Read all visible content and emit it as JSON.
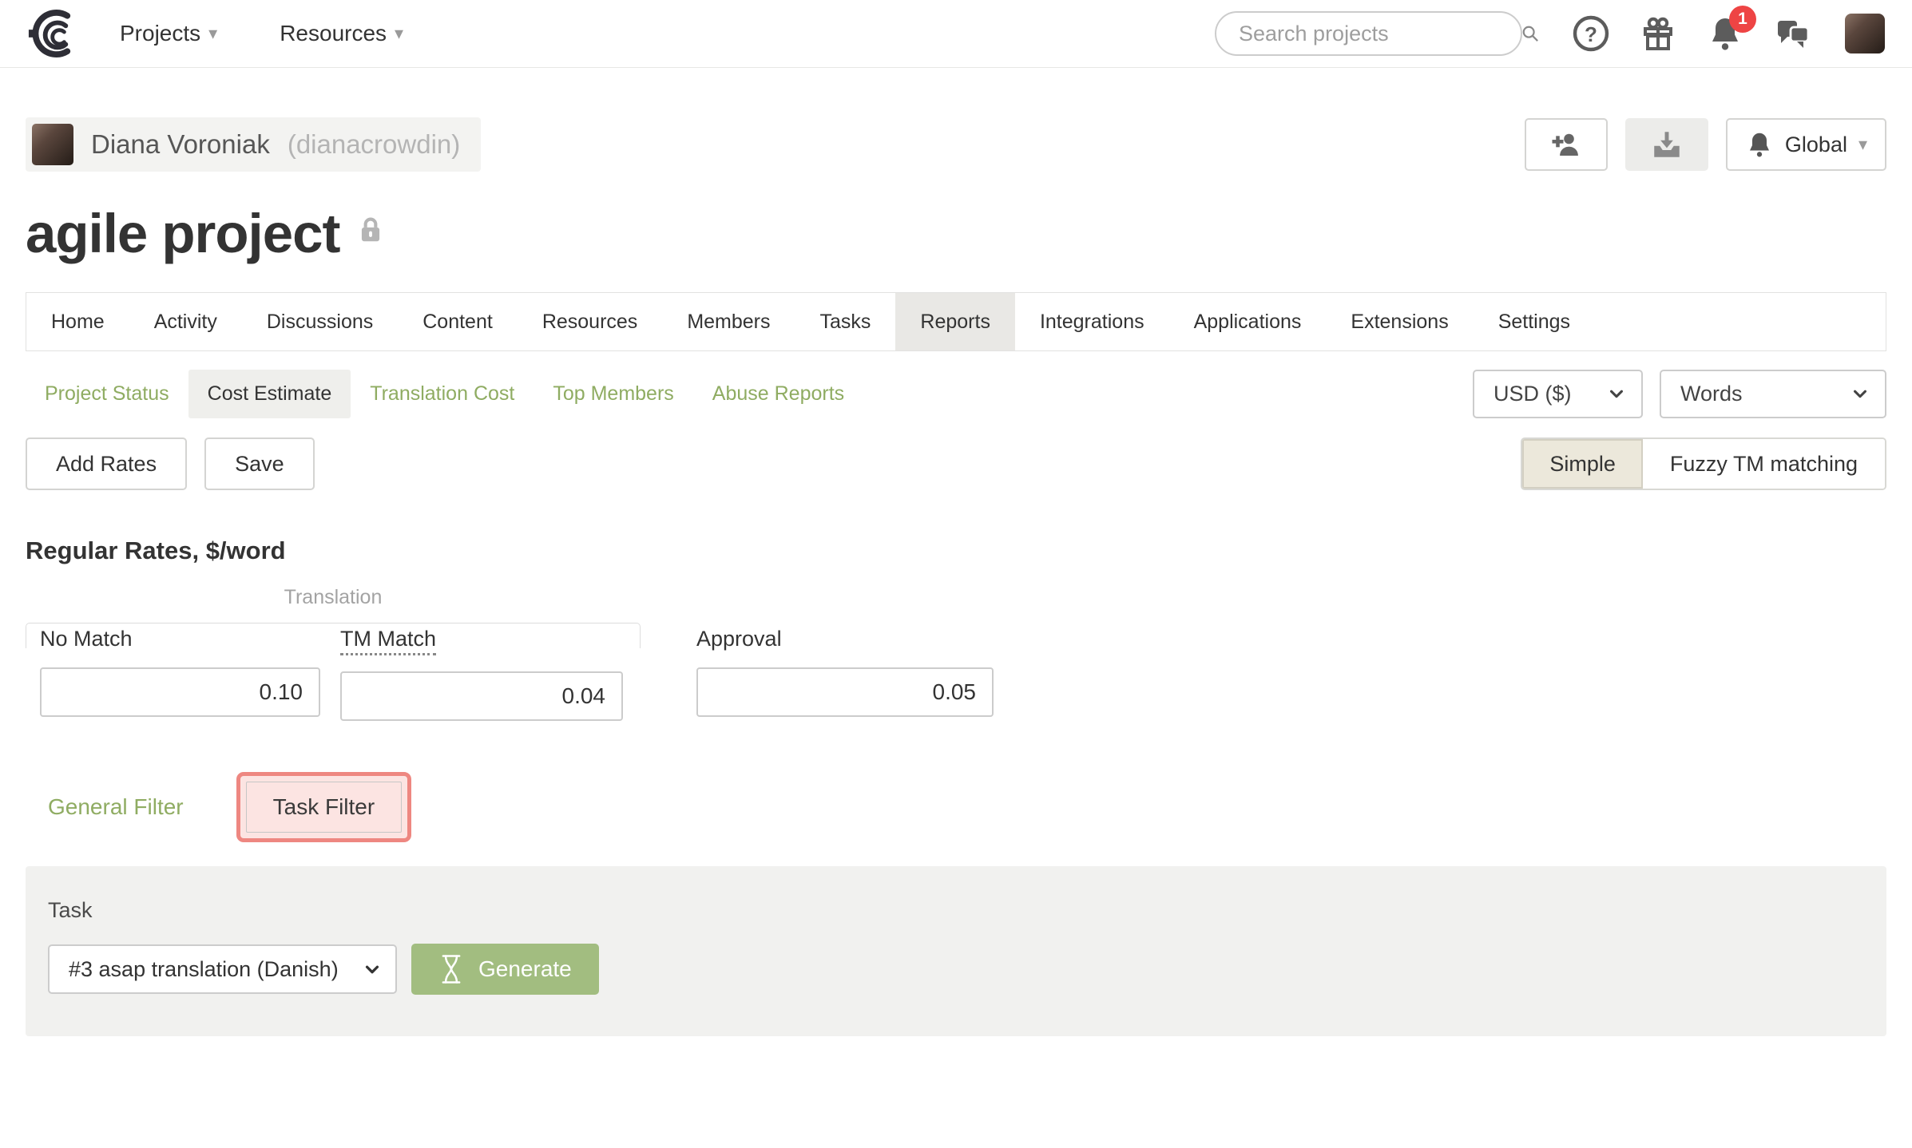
{
  "navbar": {
    "menus": {
      "projects": "Projects",
      "resources": "Resources"
    },
    "search_placeholder": "Search projects",
    "notification_count": "1"
  },
  "owner": {
    "name": "Diana Voroniak",
    "handle": "(dianacrowdin)",
    "invite_button": "",
    "global_label": "Global"
  },
  "project": {
    "title": "agile project"
  },
  "tabs": {
    "items": [
      "Home",
      "Activity",
      "Discussions",
      "Content",
      "Resources",
      "Members",
      "Tasks",
      "Reports",
      "Integrations",
      "Applications",
      "Extensions",
      "Settings"
    ],
    "active": "Reports"
  },
  "subtabs": {
    "items": [
      "Project Status",
      "Cost Estimate",
      "Translation Cost",
      "Top Members",
      "Abuse Reports"
    ],
    "active": "Cost Estimate",
    "currency_value": "USD ($)",
    "unit_value": "Words"
  },
  "toolbar": {
    "add_rates_label": "Add Rates",
    "save_label": "Save",
    "mode_simple": "Simple",
    "mode_fuzzy": "Fuzzy TM matching",
    "mode_active": "Simple"
  },
  "rates": {
    "heading": "Regular Rates, $/word",
    "group_label": "Translation",
    "fields": [
      {
        "label": "No Match",
        "value": "0.10"
      },
      {
        "label": "TM Match",
        "value": "0.04"
      },
      {
        "label": "Approval",
        "value": "0.05"
      }
    ]
  },
  "filters": {
    "general_label": "General Filter",
    "task_label": "Task Filter"
  },
  "task_panel": {
    "label": "Task",
    "selected_task": "#3 asap translation (Danish)",
    "generate_label": "Generate"
  },
  "colors": {
    "link_green": "#8fac62",
    "button_green": "#a2bd80",
    "active_tab_bg": "#e9e8e5",
    "highlight_red": "#ee8781",
    "highlight_fill": "#fce4e2",
    "badge_red": "#ee4444"
  }
}
